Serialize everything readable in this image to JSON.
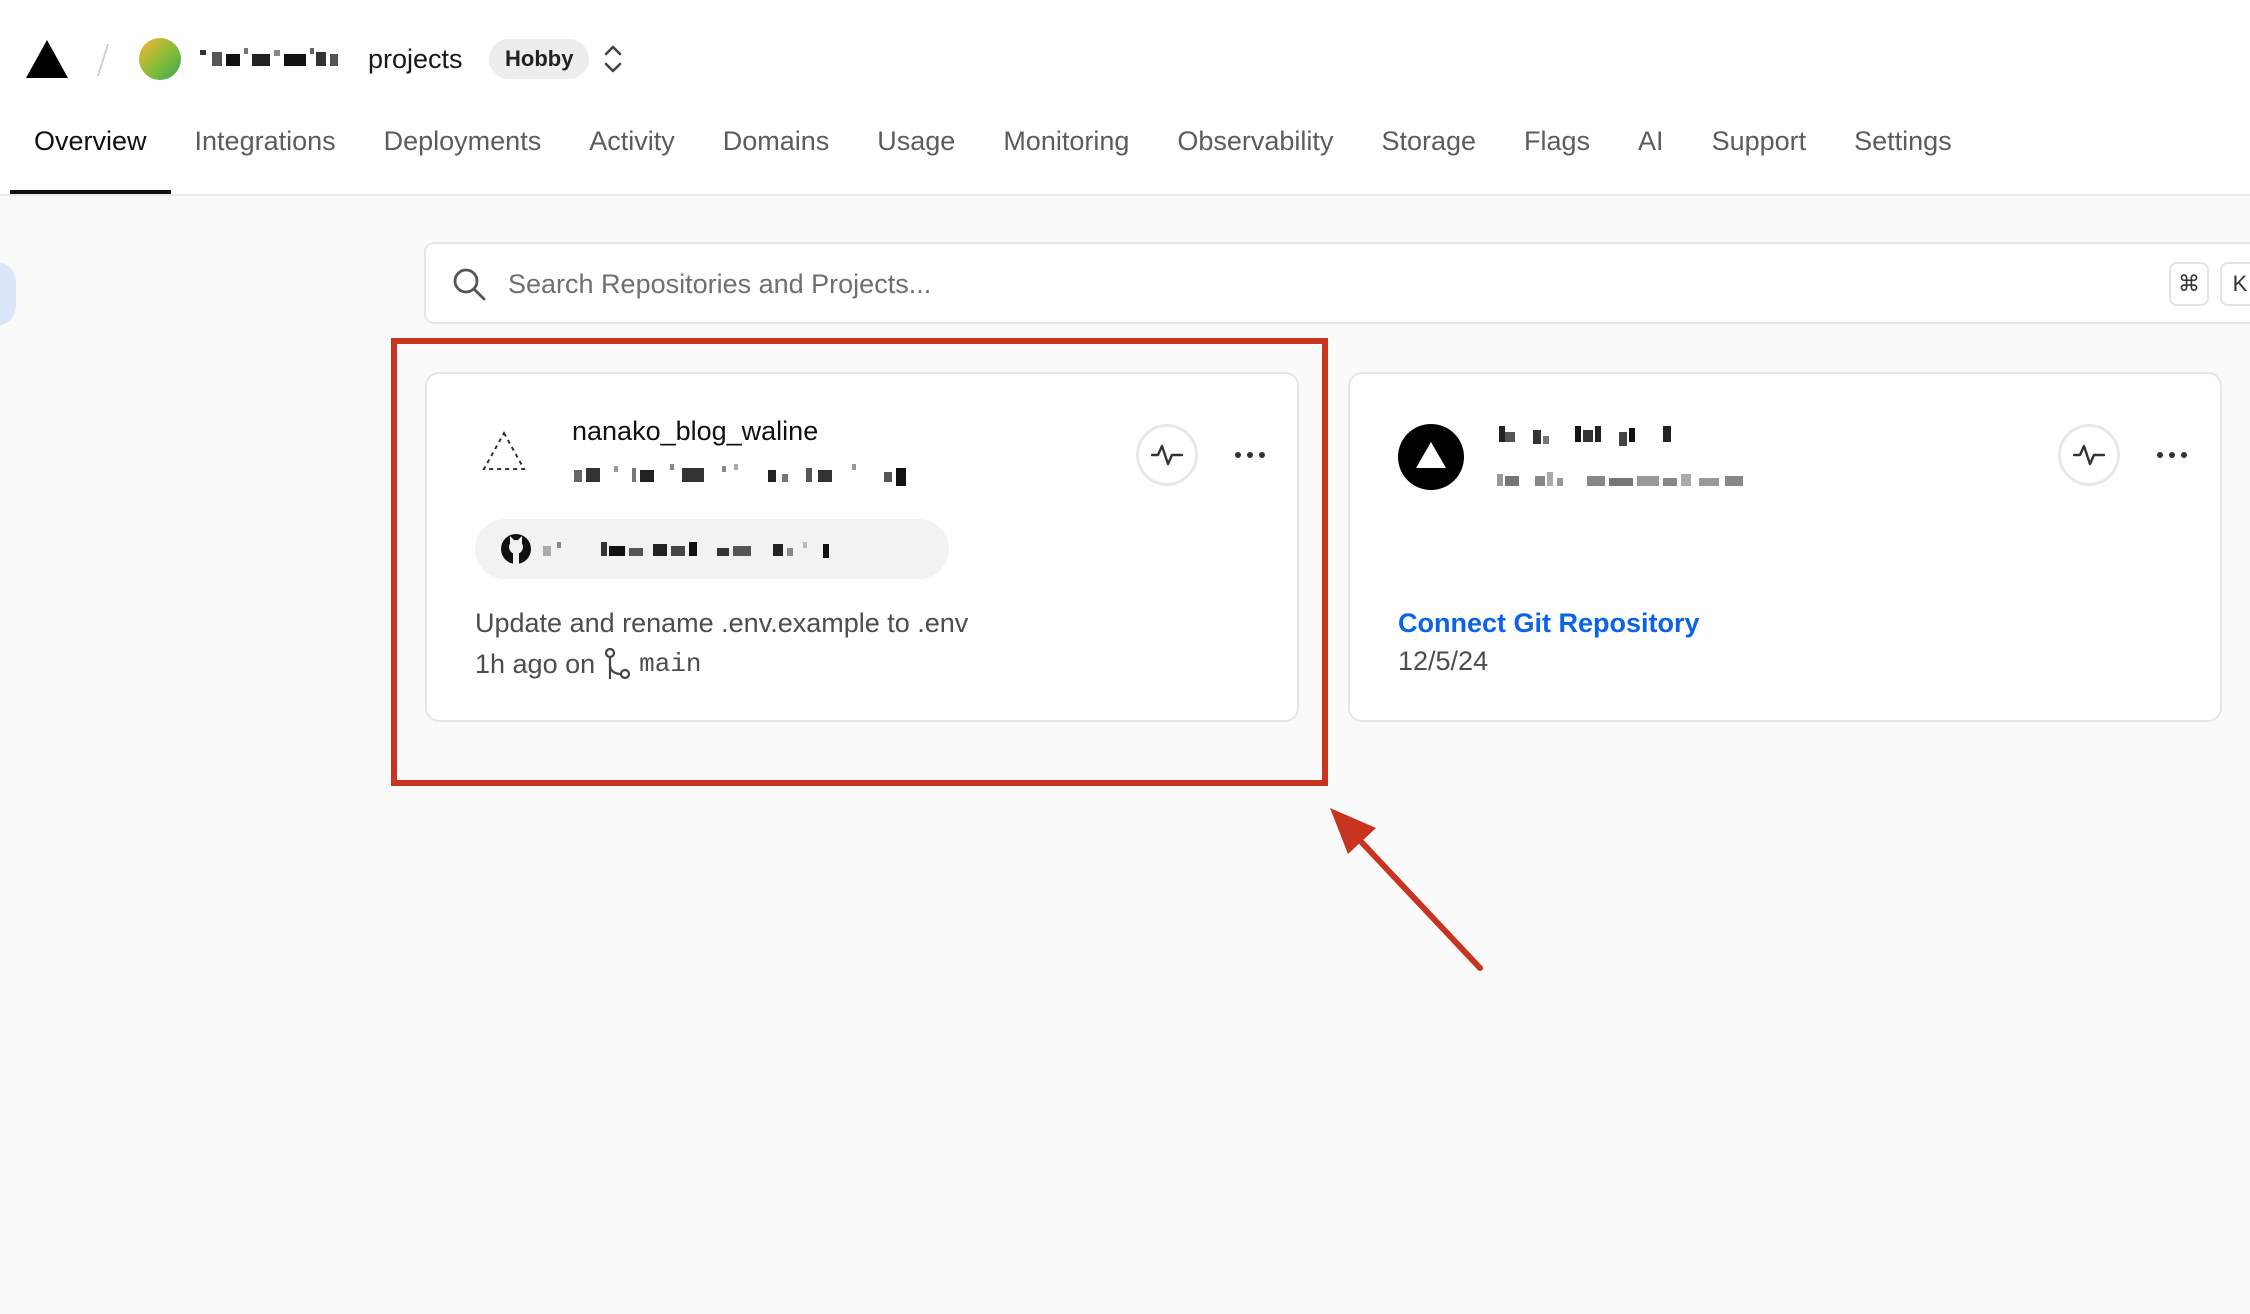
{
  "header": {
    "team_name_suffix": "projects",
    "plan_badge": "Hobby"
  },
  "tabs": [
    {
      "label": "Overview",
      "active": true
    },
    {
      "label": "Integrations"
    },
    {
      "label": "Deployments"
    },
    {
      "label": "Activity"
    },
    {
      "label": "Domains"
    },
    {
      "label": "Usage"
    },
    {
      "label": "Monitoring"
    },
    {
      "label": "Observability"
    },
    {
      "label": "Storage"
    },
    {
      "label": "Flags"
    },
    {
      "label": "AI"
    },
    {
      "label": "Support"
    },
    {
      "label": "Settings"
    }
  ],
  "search": {
    "placeholder": "Search Repositories and Projects...",
    "shortcut_keys": [
      "⌘",
      "K"
    ]
  },
  "projects": [
    {
      "name": "nanako_blog_waline",
      "commit_message": "Update and rename .env.example to .env",
      "commit_time": "1h ago on",
      "branch": "main"
    },
    {
      "connect_label": "Connect Git Repository",
      "date": "12/5/24"
    }
  ],
  "colors": {
    "accent_link": "#0a63e8",
    "annotation": "#c8341f",
    "page_background": "#fafafa"
  },
  "icons": {
    "logo": "vercel-triangle-icon",
    "search": "search-icon",
    "activity": "activity-pulse-icon",
    "more": "ellipsis-icon",
    "repo": "github-icon",
    "branch": "git-branch-icon"
  }
}
